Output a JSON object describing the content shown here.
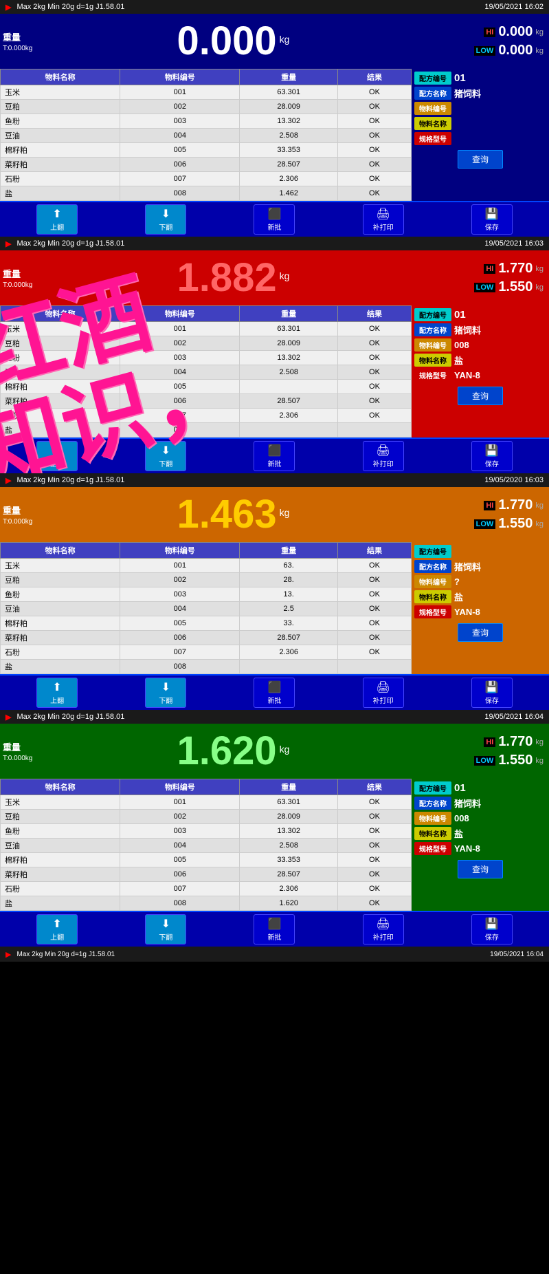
{
  "panels": [
    {
      "id": "panel1",
      "status_bar": {
        "left": "Max 2kg  Min 20g  d=1g  J1.58.01",
        "right": "19/05/2021 16:02",
        "icon": "▶"
      },
      "header_bg": "blue",
      "weight_label": "重量",
      "tare_label": "T:0.000kg",
      "weight_value": "0.000",
      "weight_unit": "kg",
      "hi_value": "0.000",
      "hi_unit": "kg",
      "low_value": "0.000",
      "low_unit": "kg",
      "hi_label": "HI",
      "low_label": "LOW",
      "table": {
        "headers": [
          "物料名称",
          "物料编号",
          "重量",
          "结果"
        ],
        "rows": [
          [
            "玉米",
            "001",
            "63.301",
            "OK"
          ],
          [
            "豆粕",
            "002",
            "28.009",
            "OK"
          ],
          [
            "鱼粉",
            "003",
            "13.302",
            "OK"
          ],
          [
            "豆油",
            "004",
            "2.508",
            "OK"
          ],
          [
            "棉籽粕",
            "005",
            "33.353",
            "OK"
          ],
          [
            "菜籽粕",
            "006",
            "28.507",
            "OK"
          ],
          [
            "石粉",
            "007",
            "2.306",
            "OK"
          ],
          [
            "盐",
            "008",
            "1.462",
            "OK"
          ]
        ]
      },
      "info": {
        "recipe_num_label": "配方编号",
        "recipe_num_value": "01",
        "recipe_name_label": "配方名称",
        "recipe_name_value": "猪饲料",
        "material_num_label": "物料编号",
        "material_num_value": "",
        "material_name_label": "物料名称",
        "material_name_value": "",
        "spec_label": "规格型号",
        "spec_value": "",
        "query_label": "查询"
      },
      "toolbar": {
        "btn1": "上翻",
        "btn2": "下翻",
        "btn3": "新批",
        "btn4": "补打印",
        "btn5": "保存"
      }
    },
    {
      "id": "panel2",
      "status_bar": {
        "left": "Max 2kg  Min 20g  d=1g  J1.58.01",
        "right": "19/05/2021 16:03",
        "icon": "▶"
      },
      "header_bg": "red",
      "weight_label": "重量",
      "tare_label": "T:0.000kg",
      "weight_value": "1.882",
      "weight_unit": "kg",
      "hi_value": "1.770",
      "hi_unit": "kg",
      "low_value": "1.550",
      "low_unit": "kg",
      "hi_label": "HI",
      "low_label": "LOW",
      "table": {
        "headers": [
          "物料名称",
          "物料编号",
          "重量",
          "结果"
        ],
        "rows": [
          [
            "玉米",
            "001",
            "63.301",
            "OK"
          ],
          [
            "豆粕",
            "002",
            "28.009",
            "OK"
          ],
          [
            "鱼粉",
            "003",
            "13.302",
            "OK"
          ],
          [
            "豆油",
            "004",
            "2.508",
            "OK"
          ],
          [
            "棉籽粕",
            "005",
            "",
            "OK"
          ],
          [
            "菜籽粕",
            "006",
            "28.507",
            "OK"
          ],
          [
            "石粉",
            "007",
            "2.306",
            "OK"
          ],
          [
            "盐",
            "008",
            "",
            ""
          ]
        ]
      },
      "info": {
        "recipe_num_label": "配方编号",
        "recipe_num_value": "01",
        "recipe_name_label": "配方名称",
        "recipe_name_value": "猪饲料",
        "material_num_label": "物料编号",
        "material_num_value": "008",
        "material_name_label": "物料名称",
        "material_name_value": "盐",
        "spec_label": "规格型号",
        "spec_value": "YAN-8",
        "query_label": "查询"
      },
      "toolbar": {
        "btn1": "上翻",
        "btn2": "下翻",
        "btn3": "新批",
        "btn4": "补打印",
        "btn5": "保存"
      },
      "overlay": true,
      "overlay_line1": "红酒",
      "overlay_line2": "知识，"
    },
    {
      "id": "panel3",
      "status_bar": {
        "left": "Max 2kg  Min 20g  d=1g  J1.58.01",
        "right": "19/05/2020 16:03",
        "icon": "▶"
      },
      "header_bg": "orange",
      "weight_label": "重量",
      "tare_label": "T:0.000kg",
      "weight_value": "1.463",
      "weight_unit": "kg",
      "hi_value": "1.770",
      "hi_unit": "kg",
      "low_value": "1.550",
      "low_unit": "kg",
      "hi_label": "HI",
      "low_label": "LOW",
      "table": {
        "headers": [
          "物料名称",
          "物料编号",
          "重量",
          "结果"
        ],
        "rows": [
          [
            "玉米",
            "001",
            "63.",
            "OK"
          ],
          [
            "豆粕",
            "002",
            "28.",
            "OK"
          ],
          [
            "鱼粉",
            "003",
            "13.",
            "OK"
          ],
          [
            "豆油",
            "004",
            "2.5",
            "OK"
          ],
          [
            "棉籽粕",
            "005",
            "33.",
            "OK"
          ],
          [
            "菜籽粕",
            "006",
            "28.507",
            "OK"
          ],
          [
            "石粉",
            "007",
            "2.306",
            "OK"
          ],
          [
            "盐",
            "008",
            "",
            ""
          ]
        ]
      },
      "info": {
        "recipe_num_label": "配方编号",
        "recipe_num_value": "",
        "recipe_name_label": "配方名称",
        "recipe_name_value": "猪饲料",
        "material_num_label": "物料编号",
        "material_num_value": "?",
        "material_name_label": "物料名称",
        "material_name_value": "盐",
        "spec_label": "规格型号",
        "spec_value": "YAN-8",
        "query_label": "查询"
      },
      "toolbar": {
        "btn1": "上翻",
        "btn2": "下翻",
        "btn3": "新批",
        "btn4": "补打印",
        "btn5": "保存"
      }
    },
    {
      "id": "panel4",
      "status_bar": {
        "left": "Max 2kg  Min 20g  d=1g  J1.58.01",
        "right": "19/05/2021 16:04",
        "icon": "▶"
      },
      "header_bg": "green",
      "weight_label": "重量",
      "tare_label": "T:0.000kg",
      "weight_value": "1.620",
      "weight_unit": "kg",
      "hi_value": "1.770",
      "hi_unit": "kg",
      "low_value": "1.550",
      "low_unit": "kg",
      "hi_label": "HI",
      "low_label": "LOW",
      "table": {
        "headers": [
          "物料名称",
          "物料编号",
          "重量",
          "结果"
        ],
        "rows": [
          [
            "玉米",
            "001",
            "63.301",
            "OK"
          ],
          [
            "豆粕",
            "002",
            "28.009",
            "OK"
          ],
          [
            "鱼粉",
            "003",
            "13.302",
            "OK"
          ],
          [
            "豆油",
            "004",
            "2.508",
            "OK"
          ],
          [
            "棉籽粕",
            "005",
            "33.353",
            "OK"
          ],
          [
            "菜籽粕",
            "006",
            "28.507",
            "OK"
          ],
          [
            "石粉",
            "007",
            "2.306",
            "OK"
          ],
          [
            "盐",
            "008",
            "1.620",
            "OK"
          ]
        ]
      },
      "info": {
        "recipe_num_label": "配方编号",
        "recipe_num_value": "01",
        "recipe_name_label": "配方名称",
        "recipe_name_value": "猪饲料",
        "material_num_label": "物料编号",
        "material_num_value": "008",
        "material_name_label": "物料名称",
        "material_name_value": "盐",
        "spec_label": "规格型号",
        "spec_value": "YAN-8",
        "query_label": "查询"
      },
      "toolbar": {
        "btn1": "上翻",
        "btn2": "下翻",
        "btn3": "新批",
        "btn4": "补打印",
        "btn5": "保存"
      }
    }
  ],
  "bottom_bar": {
    "icon": "▶",
    "text": "Max 2kg  Min 20g  d=1g  J1.58.01",
    "time": "19/05/2021 16:04"
  },
  "colors": {
    "blue_header": "#000080",
    "red_header": "#cc0000",
    "orange_header": "#cc6600",
    "green_header": "#006600",
    "table_header": "#4040c0",
    "toolbar": "#0000aa",
    "overlay": "#ff1493"
  }
}
